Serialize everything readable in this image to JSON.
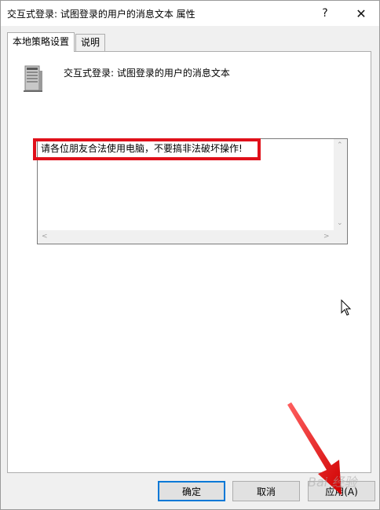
{
  "window": {
    "title": "交互式登录: 试图登录的用户的消息文本 属性",
    "help_label": "?",
    "close_label": "✕"
  },
  "tabs": [
    {
      "label": "本地策略设置",
      "active": true
    },
    {
      "label": "说明",
      "active": false
    }
  ],
  "policy": {
    "icon": "server-computer-icon",
    "title": "交互式登录: 试图登录的用户的消息文本"
  },
  "message_field": {
    "value": "请各位朋友合法使用电脑，不要搞非法破坏操作!"
  },
  "buttons": {
    "ok": "确定",
    "cancel": "取消",
    "apply": "应用(A)"
  },
  "watermark": "Bai 经验",
  "colors": {
    "annotation_red": "#e0101a",
    "focus_blue": "#0078d7"
  }
}
